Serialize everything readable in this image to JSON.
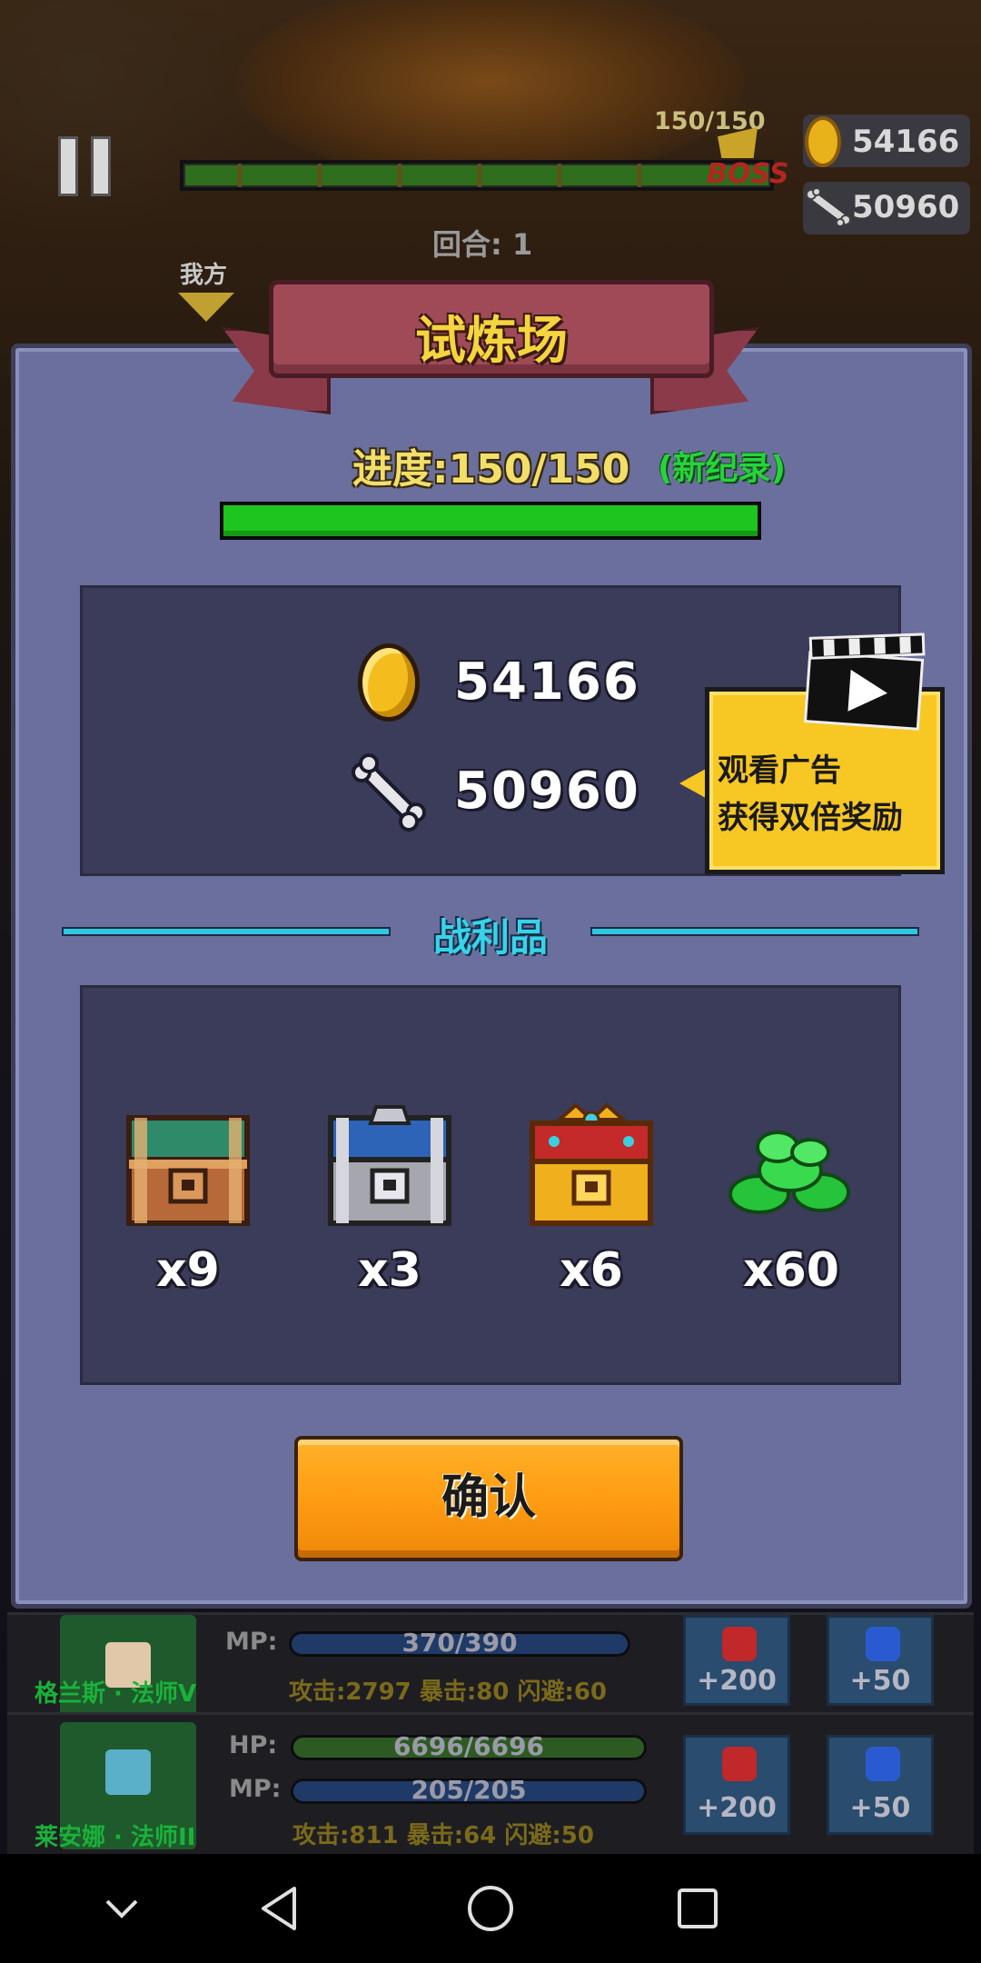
{
  "hud": {
    "boss_hp": "150/150",
    "boss_label": "BOSS",
    "coins": "54166",
    "bones": "50960",
    "round": "回合: 1",
    "my_side": "我方",
    "wave_progress": 1.0
  },
  "dialog": {
    "title": "试炼场",
    "progress_text": "进度:150/150",
    "record_tag": "(新纪录)",
    "progress_fraction": 1.0,
    "rewards": {
      "coins": "54166",
      "bones": "50960"
    },
    "ad_offer": {
      "line1": "观看广告",
      "line2": "获得双倍奖励"
    },
    "loot_title": "战利品",
    "loot": [
      {
        "name": "green-chest",
        "qty": "x9"
      },
      {
        "name": "blue-chest",
        "qty": "x3"
      },
      {
        "name": "gold-chest",
        "qty": "x6"
      },
      {
        "name": "emerald-gems",
        "qty": "x60"
      }
    ],
    "confirm_label": "确认"
  },
  "heroes": [
    {
      "name": "格兰斯 · 法师V",
      "mp_label": "MP:",
      "mp": "370/390",
      "mp_fraction": 0.95,
      "stats": "攻击:2797  暴击:80  闪避:60",
      "potion_hp": "+200",
      "potion_mp": "+50"
    },
    {
      "name": "莱安娜 · 法师II",
      "hp_label": "HP:",
      "hp": "6696/6696",
      "hp_fraction": 1.0,
      "mp_label": "MP:",
      "mp": "205/205",
      "mp_fraction": 1.0,
      "stats": "攻击:811  暴击:64  闪避:50",
      "potion_hp": "+200",
      "potion_mp": "+50"
    }
  ],
  "colors": {
    "panel": "#6b6f9d",
    "progress_green": "#1ec51e",
    "title_gold": "#f6d440",
    "loot_cyan": "#39d2ec",
    "confirm_orange": "#ff9d12",
    "ad_yellow": "#f7c724"
  }
}
